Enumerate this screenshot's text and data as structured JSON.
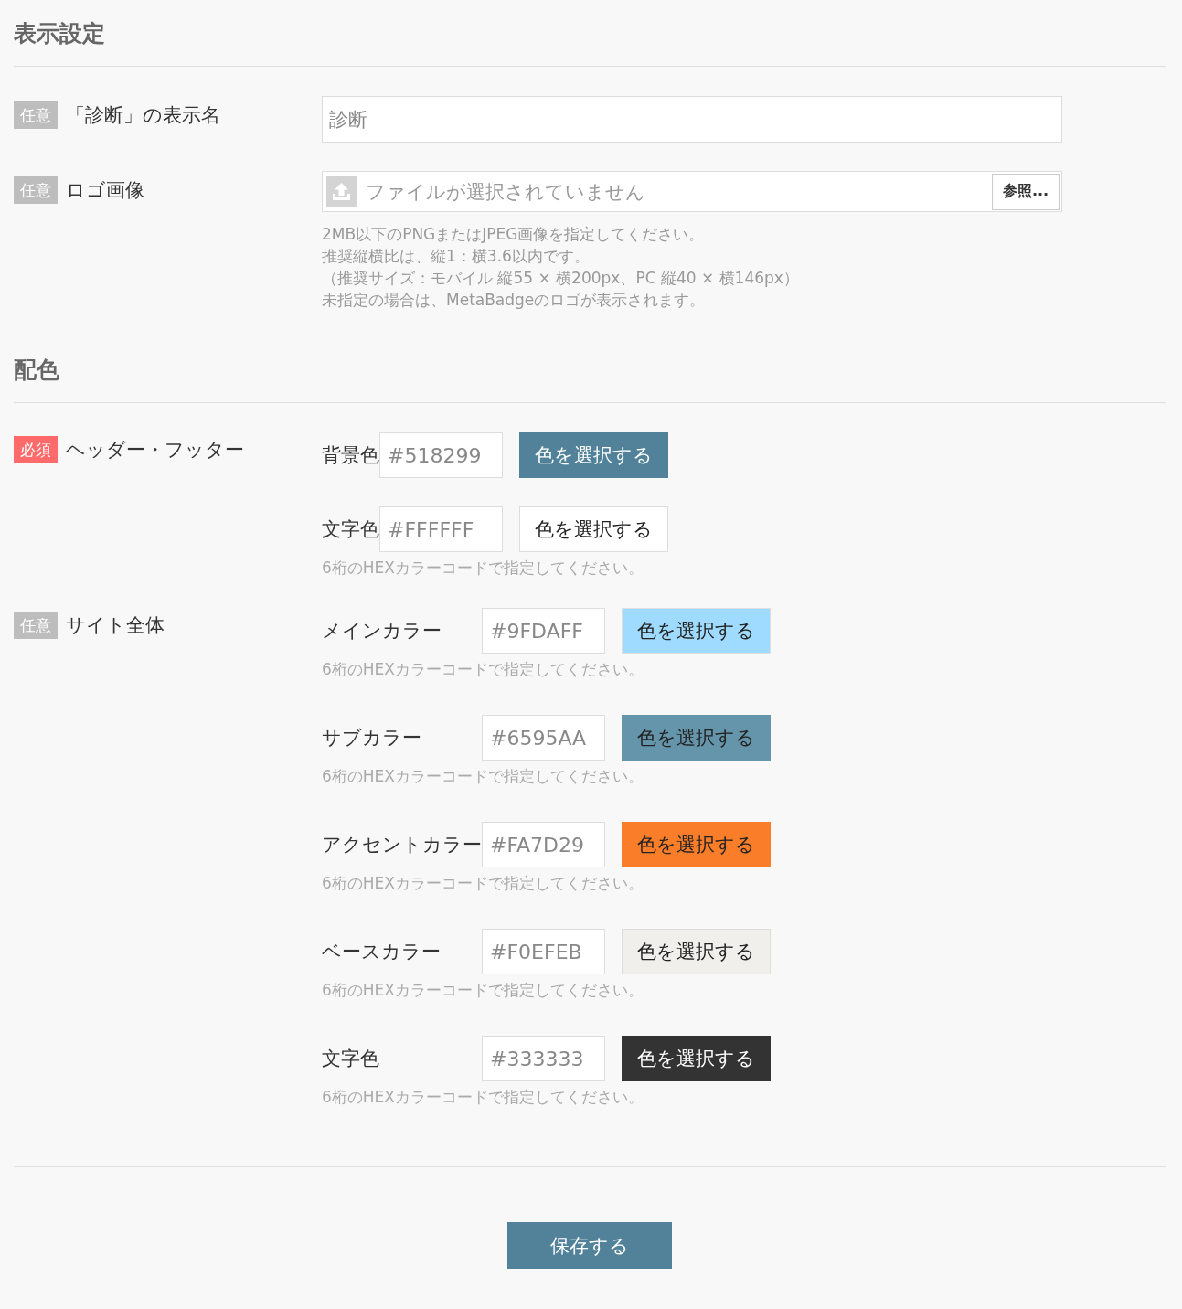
{
  "sections": [
    {
      "title": "表示設定",
      "rows": [
        {
          "kind": "text",
          "badge": {
            "kind": "optional",
            "text": "任意"
          },
          "label": "「診断」の表示名",
          "value": "診断"
        },
        {
          "kind": "file",
          "badge": {
            "kind": "optional",
            "text": "任意"
          },
          "label": "ロゴ画像",
          "placeholder": "ファイルが選択されていません",
          "button": "参照...",
          "notes": [
            "2MB以下のPNGまたはJPEG画像を指定してください。",
            "推奨縦横比は、縦1：横3.6以内です。",
            "（推奨サイズ：モバイル 縦55 × 横200px、PC 縦40 × 横146px）",
            "未指定の場合は、MetaBadgeのロゴが表示されます。"
          ]
        }
      ]
    },
    {
      "title": "配色",
      "rows": [
        {
          "kind": "colors",
          "badge": {
            "kind": "required",
            "text": "必須"
          },
          "label": "ヘッダー・フッター",
          "colors": [
            {
              "label": "背景色",
              "value": "#518299",
              "color": "#518299",
              "button": "色を選択する"
            },
            {
              "label": "文字色",
              "value": "#FFFFFF",
              "color": "#ffffff",
              "button": "色を選択する",
              "hint": "6桁のHEXカラーコードで指定してください。"
            }
          ]
        },
        {
          "kind": "colors",
          "badge": {
            "kind": "optional",
            "text": "任意"
          },
          "label": "サイト全体",
          "colors": [
            {
              "label": "メインカラー",
              "value": "#9FDAFF",
              "color": "#9fdaff",
              "button": "色を選択する",
              "hint": "6桁のHEXカラーコードで指定してください。"
            },
            {
              "label": "サブカラー",
              "value": "#6595AA",
              "color": "#6595aa",
              "button": "色を選択する",
              "hint": "6桁のHEXカラーコードで指定してください。"
            },
            {
              "label": "アクセントカラー",
              "value": "#FA7D29",
              "color": "#fa7d29",
              "button": "色を選択する",
              "hint": "6桁のHEXカラーコードで指定してください。"
            },
            {
              "label": "ベースカラー",
              "value": "#F0EFEB",
              "color": "#f0efeb",
              "button": "色を選択する",
              "hint": "6桁のHEXカラーコードで指定してください。"
            },
            {
              "label": "文字色",
              "value": "#333333",
              "color": "#333333",
              "button": "色を選択する",
              "hint": "6桁のHEXカラーコードで指定してください。"
            }
          ]
        }
      ]
    }
  ],
  "save_button": "保存する"
}
